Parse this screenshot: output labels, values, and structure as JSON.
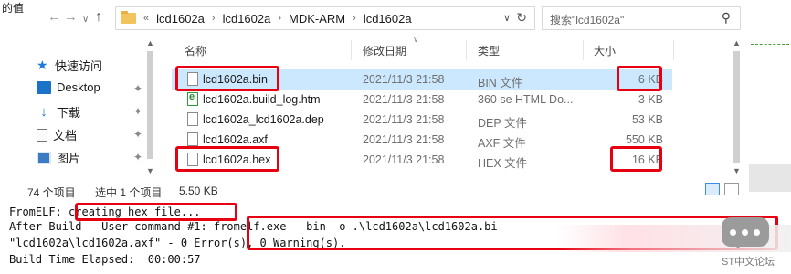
{
  "window": {
    "corner_text": "的值",
    "nav": {
      "back": "←",
      "forward": "→",
      "recent": "∨",
      "up": "↑"
    }
  },
  "address": {
    "overflow": "«",
    "crumbs": [
      "lcd1602a",
      "lcd1602a",
      "MDK-ARM",
      "lcd1602a"
    ],
    "separator": "›",
    "dropdown": "∨",
    "refresh": "↻"
  },
  "search": {
    "placeholder": "搜索\"lcd1602a\"",
    "icon": "search-icon"
  },
  "sidebar": {
    "items": [
      {
        "label": "快速访问",
        "icon": "star-icon",
        "pinned": false
      },
      {
        "label": "Desktop",
        "icon": "desktop-icon",
        "pinned": true
      },
      {
        "label": "下载",
        "icon": "download-icon",
        "pinned": true
      },
      {
        "label": "文档",
        "icon": "document-icon",
        "pinned": true
      },
      {
        "label": "图片",
        "icon": "pictures-icon",
        "pinned": true
      }
    ],
    "pin_glyph": "📌"
  },
  "columns": {
    "name": "名称",
    "date": "修改日期",
    "type": "类型",
    "size": "大小"
  },
  "files": [
    {
      "name": "lcd1602a.bin",
      "date": "2021/11/3 21:58",
      "type": "BIN 文件",
      "size": "6 KB",
      "selected": true,
      "icon": "file-icon"
    },
    {
      "name": "lcd1602a.build_log.htm",
      "date": "2021/11/3 21:58",
      "type": "360 se HTML Do...",
      "size": "3 KB",
      "selected": false,
      "icon": "html-file-icon"
    },
    {
      "name": "lcd1602a_lcd1602a.dep",
      "date": "2021/11/3 21:58",
      "type": "DEP 文件",
      "size": "53 KB",
      "selected": false,
      "icon": "file-icon"
    },
    {
      "name": "lcd1602a.axf",
      "date": "2021/11/3 21:58",
      "type": "AXF 文件",
      "size": "550 KB",
      "selected": false,
      "icon": "file-icon"
    },
    {
      "name": "lcd1602a.hex",
      "date": "2021/11/3 21:58",
      "type": "HEX 文件",
      "size": "16 KB",
      "selected": false,
      "icon": "file-icon"
    }
  ],
  "status": {
    "count": "74 个项目",
    "selection": "选中 1 个项目",
    "size": "5.50 KB"
  },
  "output": {
    "line1_prefix": "FromELF: ",
    "line1_highlight": "creating hex file...",
    "line2_prefix": "After Build - User command #1: ",
    "line2_command": "fromelf.exe --bin -o .\\lcd1602a\\lcd1602a.bi",
    "line3": "\"lcd1602a\\lcd1602a.axf\" - 0 Error(s), 0 Warning(s).",
    "line4": "Build Time Elapsed:  00:00:57"
  },
  "watermark": {
    "text": "ST中文论坛"
  },
  "colors": {
    "highlight": "#e60012",
    "selection": "#cce8ff"
  }
}
